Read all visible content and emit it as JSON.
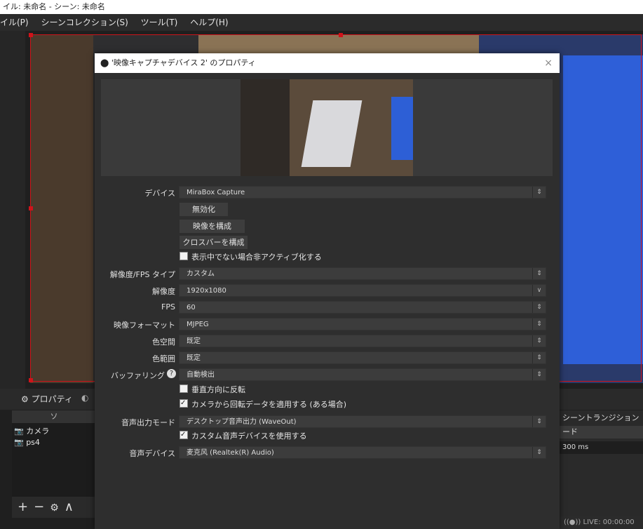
{
  "window": {
    "title": "イル: 未命名 - シーン: 未命名"
  },
  "menu": [
    "イル(P)",
    "シーンコレクション(S)",
    "ツール(T)",
    "ヘルプ(H)"
  ],
  "dialog": {
    "title": "'映像キャプチャデバイス 2' のプロパティ",
    "close": "×",
    "device_label": "デバイス",
    "device_value": "MiraBox Capture",
    "btn_disable": "無効化",
    "btn_config_video": "映像を構成",
    "btn_config_crossbar": "クロスバーを構成",
    "chk_deactivate": "表示中でない場合非アクティブ化する",
    "res_type_label": "解像度/FPS タイプ",
    "res_type_value": "カスタム",
    "resolution_label": "解像度",
    "resolution_value": "1920x1080",
    "fps_label": "FPS",
    "fps_value": "60",
    "format_label": "映像フォーマット",
    "format_value": "MJPEG",
    "colorspace_label": "色空間",
    "colorspace_value": "既定",
    "colorrange_label": "色範囲",
    "colorrange_value": "既定",
    "buffering_label": "バッファリング",
    "buffering_value": "自動検出",
    "chk_flip": "垂直方向に反転",
    "chk_rotation": "カメラから回転データを適用する (ある場合)",
    "audio_mode_label": "音声出力モード",
    "audio_mode_value": "デスクトップ音声出力 (WaveOut)",
    "chk_custom_audio": "カスタム音声デバイスを使用する",
    "audio_device_label": "音声デバイス",
    "audio_device_value": "麦克风 (Realtek(R) Audio)"
  },
  "dock": {
    "properties_label": "プロパティ",
    "sources_header": "ソ",
    "sources": [
      "カメラ",
      "ps4"
    ],
    "transition_header": "シーントランジション",
    "transition_mode": "ード",
    "duration": "300 ms",
    "live_status": "LIVE: 00:00:00"
  }
}
